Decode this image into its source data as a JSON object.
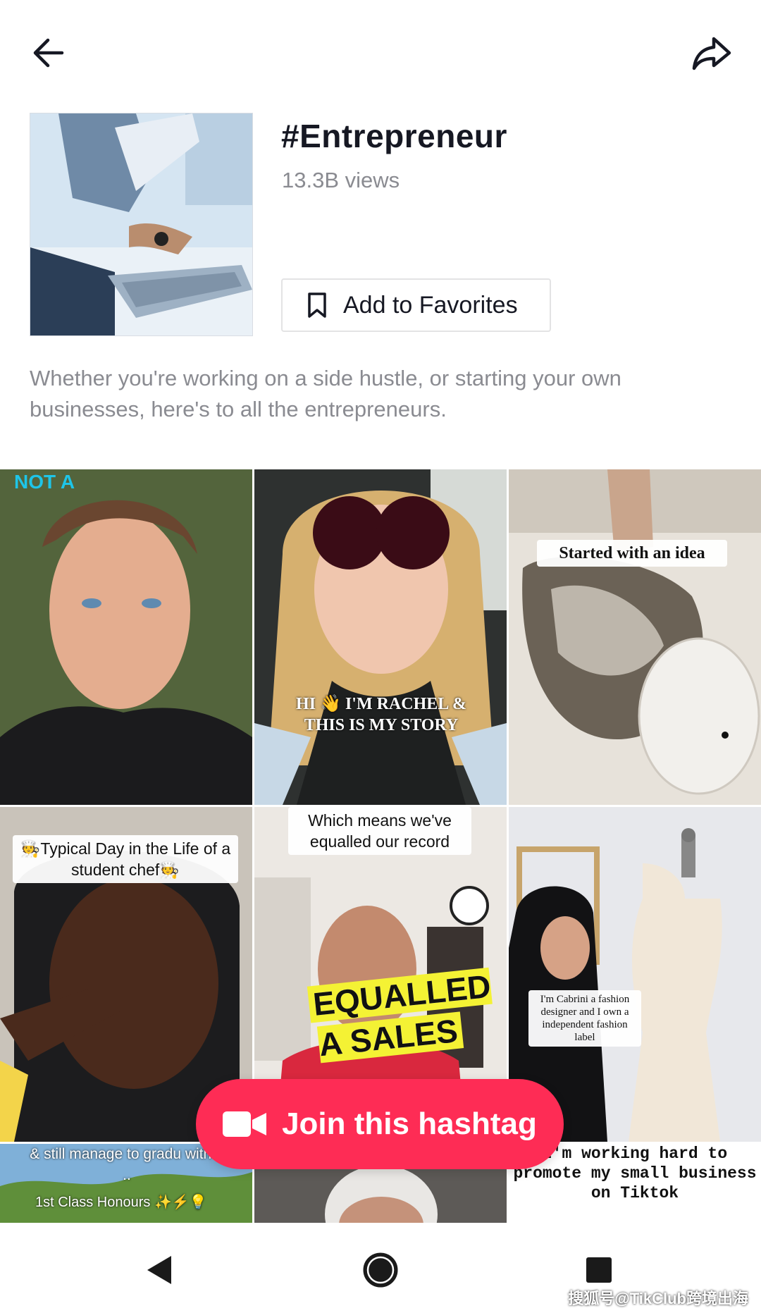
{
  "topbar": {
    "back_icon": "arrow-left-icon",
    "share_icon": "share-arrow-icon"
  },
  "hashtag": {
    "title": "#Entrepreneur",
    "views": "13.3B views",
    "favorite_label": "Add to Favorites",
    "description": "Whether you're working on a side hustle, or starting your own businesses, here's to all the entrepreneurs."
  },
  "videos": [
    {
      "caption": "NOT A"
    },
    {
      "caption": "HI 👋 I'M RACHEL & THIS IS MY STORY"
    },
    {
      "caption": "Started with an idea"
    },
    {
      "caption": "🧑‍🍳Typical Day in the Life of a student chef🧑‍🍳"
    },
    {
      "caption_top": "Which means we've equalled our record",
      "caption_big": "EQUALLED A SALES"
    },
    {
      "caption": "I'm Cabrini a fashion designer and I own a independent fashion label"
    },
    {
      "caption_top": "& still manage to gradu with a ..",
      "caption_bottom": "1st Class Honours ✨⚡💡"
    },
    {
      "caption": ""
    },
    {
      "caption": "I'm working hard to promote my small business on Tiktok"
    }
  ],
  "join_button": {
    "label": "Join this hashtag",
    "color": "#fe2c55"
  },
  "watermark": "搜狐号@TikClub跨境出海"
}
